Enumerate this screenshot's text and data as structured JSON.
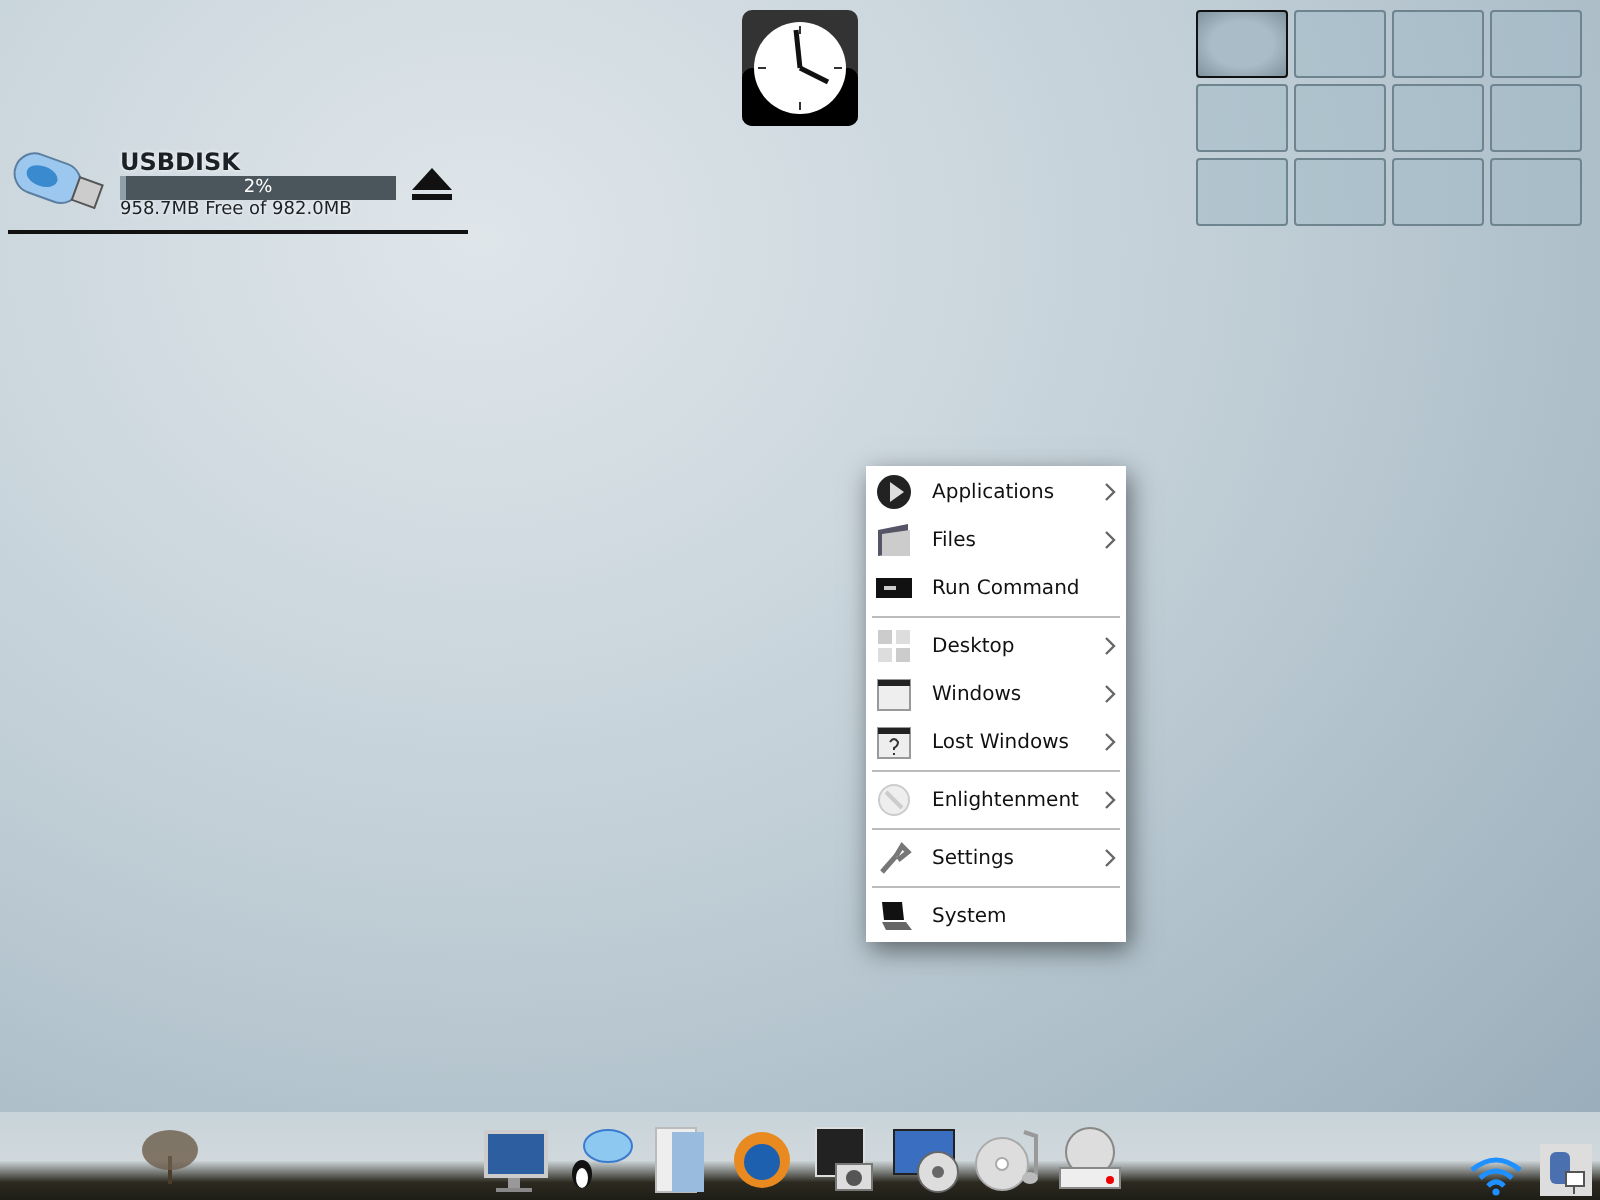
{
  "usb_gadget": {
    "name": "USBDISK",
    "level": 0.02,
    "percent": "2%",
    "free_text": "958.7MB Free of 982.0MB"
  },
  "pager": {
    "desks": [
      {
        "selected": true
      },
      {
        "selected": false
      },
      {
        "selected": false
      },
      {
        "selected": false
      },
      {
        "selected": false
      },
      {
        "selected": false
      },
      {
        "selected": false
      },
      {
        "selected": false
      },
      {
        "selected": false
      },
      {
        "selected": false
      },
      {
        "selected": false
      },
      {
        "selected": false
      }
    ]
  },
  "menu": {
    "groups": [
      [
        {
          "label": "Applications",
          "submenu": true
        },
        {
          "label": "Files",
          "submenu": true
        },
        {
          "label": "Run Command",
          "submenu": false
        }
      ],
      [
        {
          "label": "Desktop",
          "submenu": true
        },
        {
          "label": "Windows",
          "submenu": true
        },
        {
          "label": "Lost Windows",
          "submenu": true
        }
      ],
      [
        {
          "label": "Enlightenment",
          "submenu": true
        }
      ],
      [
        {
          "label": "Settings",
          "submenu": true
        }
      ],
      [
        {
          "label": "System",
          "submenu": false
        }
      ]
    ]
  }
}
